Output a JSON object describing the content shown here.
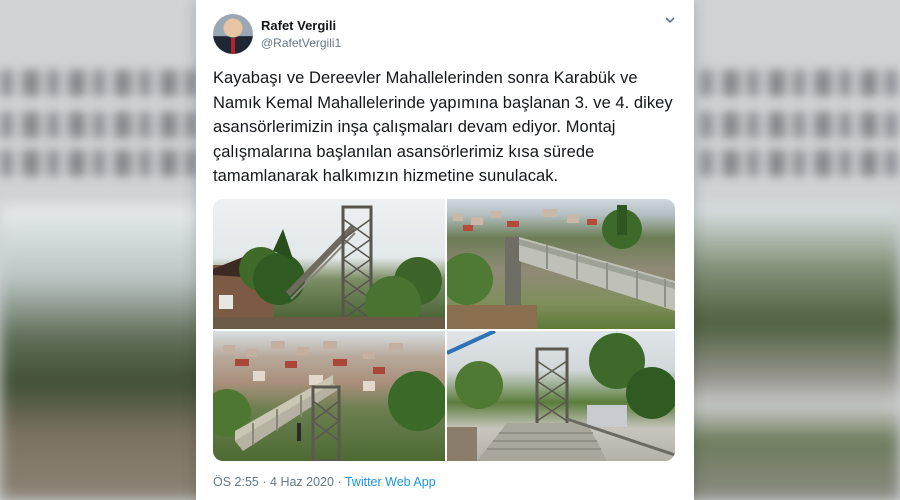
{
  "tweet": {
    "author_name": "Rafet Vergili",
    "author_handle": "@RafetVergili1",
    "text": "Kayabaşı ve Dereevler Mahallelerinden sonra Karabük ve Namık Kemal Mahallelerinde yapımına başlanan 3. ve 4. dikey asansörlerimizin inşa çalışmaları devam ediyor. Montaj çalışmalarına başlanılan asansörlerimiz kısa sürede tamamlanarak halkımızın hizmetine sunulacak.",
    "time": "ÖS 2:55",
    "separator": "·",
    "date": "4 Haz 2020",
    "source": "Twitter Web App",
    "menu_icon": "chevron-down-icon"
  },
  "colors": {
    "name_text": "#14171a",
    "secondary_text": "#657786",
    "link": "#1b95e0",
    "card_background": "#ffffff"
  }
}
